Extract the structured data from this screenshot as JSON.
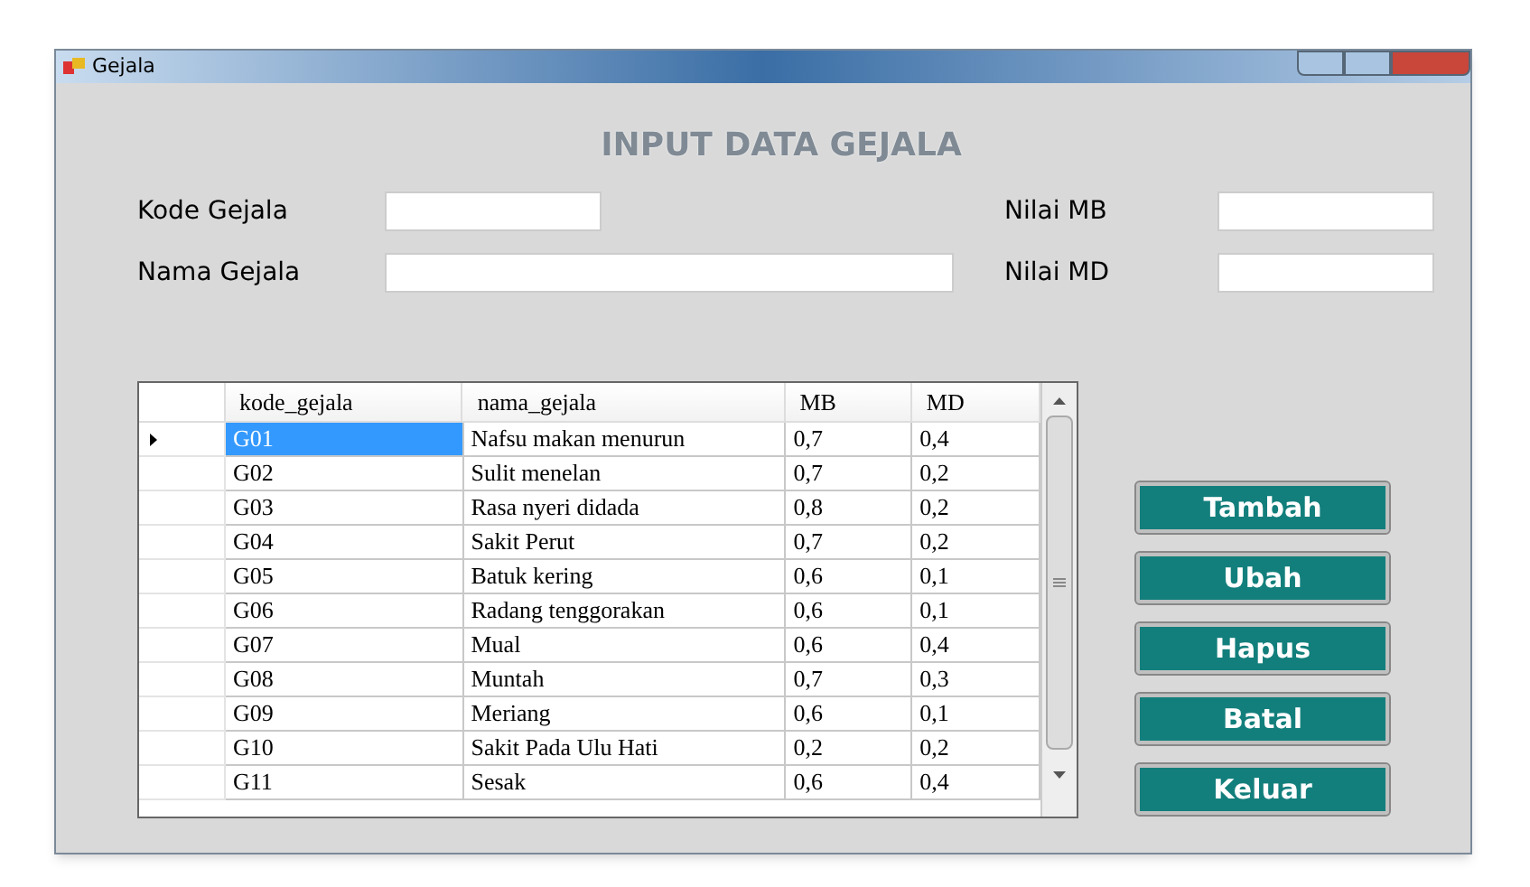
{
  "window": {
    "title": "Gejala"
  },
  "heading": "INPUT DATA GEJALA",
  "fields": [
    {
      "label": "Kode Gejala"
    },
    {
      "label": "Nama Gejala"
    },
    {
      "label": "Nilai MB"
    },
    {
      "label": "Nilai MD"
    }
  ],
  "table": {
    "columns": [
      "kode_gejala",
      "nama_gejala",
      "MB",
      "MD"
    ],
    "rows": [
      {
        "cells": [
          "G01",
          "Nafsu makan menurun",
          "0,7",
          "0,4"
        ],
        "selected": true
      },
      {
        "cells": [
          "G02",
          "Sulit menelan",
          "0,7",
          "0,2"
        ],
        "selected": false
      },
      {
        "cells": [
          "G03",
          "Rasa nyeri didada",
          "0,8",
          "0,2"
        ],
        "selected": false
      },
      {
        "cells": [
          "G04",
          "Sakit Perut",
          "0,7",
          "0,2"
        ],
        "selected": false
      },
      {
        "cells": [
          "G05",
          "Batuk kering",
          "0,6",
          "0,1"
        ],
        "selected": false
      },
      {
        "cells": [
          "G06",
          "Radang tenggorakan",
          "0,6",
          "0,1"
        ],
        "selected": false
      },
      {
        "cells": [
          "G07",
          "Mual",
          "0,6",
          "0,4"
        ],
        "selected": false
      },
      {
        "cells": [
          "G08",
          "Muntah",
          "0,7",
          "0,3"
        ],
        "selected": false
      },
      {
        "cells": [
          "G09",
          "Meriang",
          "0,6",
          "0,1"
        ],
        "selected": false
      },
      {
        "cells": [
          "G10",
          "Sakit Pada Ulu Hati",
          "0,2",
          "0,2"
        ],
        "selected": false
      },
      {
        "cells": [
          "G11",
          "Sesak",
          "0,6",
          "0,4"
        ],
        "selected": false
      }
    ]
  },
  "buttons": [
    "Tambah",
    "Ubah",
    "Hapus",
    "Batal",
    "Keluar"
  ]
}
